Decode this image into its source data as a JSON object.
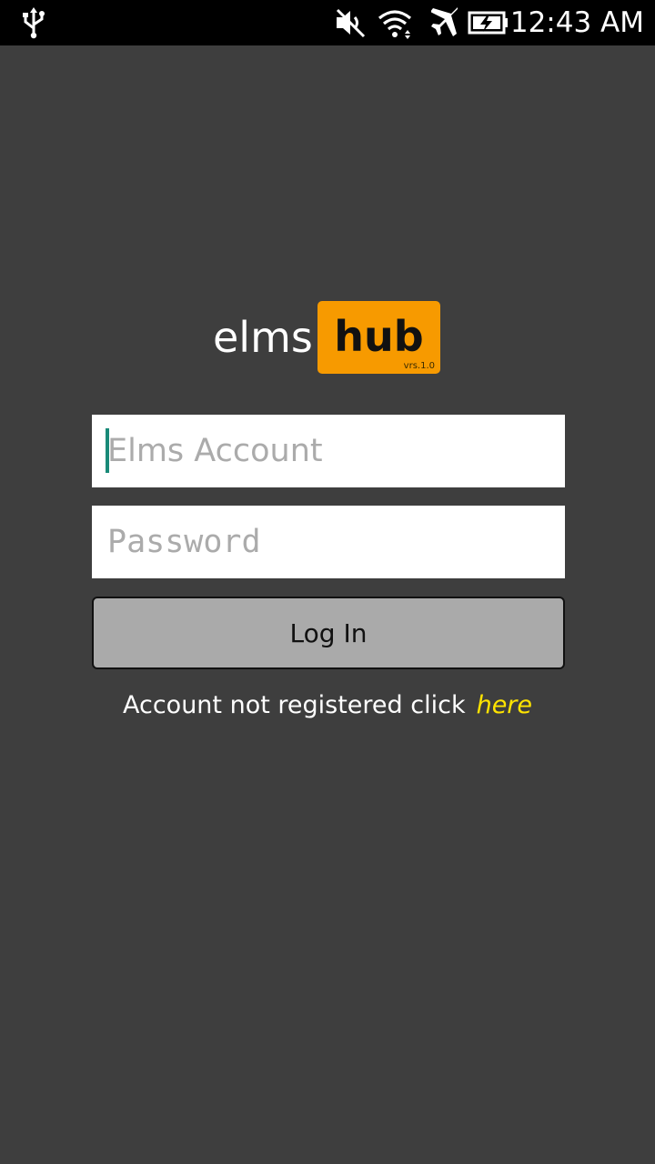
{
  "status_bar": {
    "time": "12:43 AM",
    "icons": [
      "usb-icon",
      "mute-icon",
      "wifi-icon",
      "airplane-mode-icon",
      "battery-charging-icon"
    ]
  },
  "logo": {
    "word1": "elms",
    "word2": "hub",
    "version": "vrs.1.0",
    "accent_color": "#f79a00"
  },
  "form": {
    "account_placeholder": "Elms Account",
    "account_value": "",
    "password_placeholder": "Password",
    "password_value": "",
    "login_label": "Log In"
  },
  "register": {
    "text": "Account not registered click",
    "link_label": "here",
    "link_color": "#ffe400"
  },
  "colors": {
    "background": "#3e3e3e",
    "button": "#aaaaaa"
  }
}
